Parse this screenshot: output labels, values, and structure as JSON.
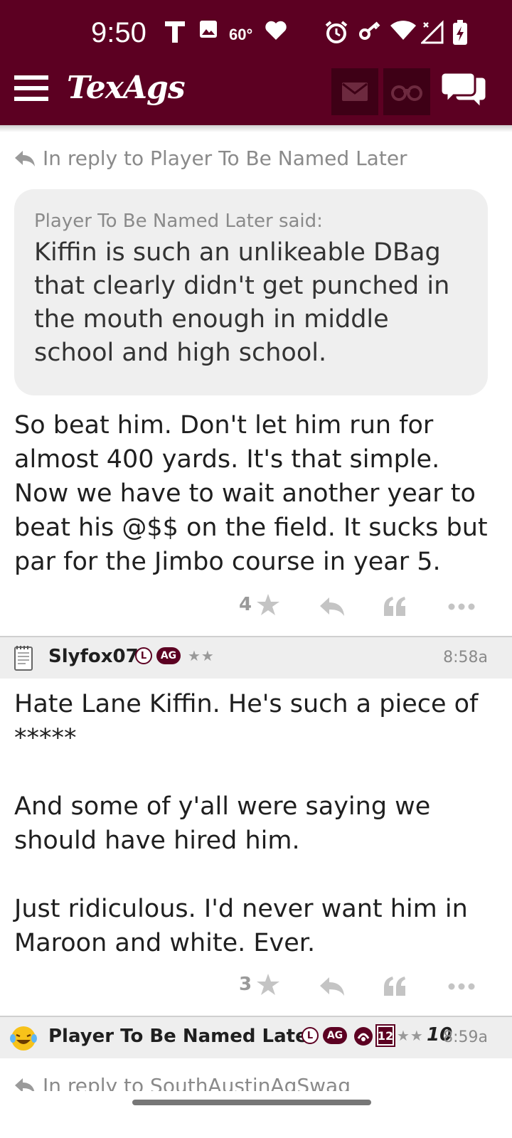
{
  "status_bar": {
    "time": "9:50",
    "temperature": "60°",
    "icons": [
      "t-mobile-icon",
      "image-icon",
      "heart-icon",
      "alarm-icon",
      "key-icon",
      "wifi-icon",
      "signal-icon",
      "battery-charging-icon"
    ]
  },
  "app_bar": {
    "logo": "TexAgs",
    "accent_color": "#5c0022",
    "icons": [
      "menu-icon",
      "mail-icon",
      "binoculars-icon",
      "chat-icon"
    ]
  },
  "posts": [
    {
      "reply_to": "In reply to Player To Be Named Later",
      "quote": {
        "author": "Player To Be Named Later said:",
        "text": "Kiffin is such an unlikeable DBag that clearly didn't get punched in the mouth enough in middle school and high school."
      },
      "body": "So beat him. Don't let him run for almost 400 yards. It's that simple. Now we have to wait another year to beat his @$$ on the field. It sucks but par for the Jimbo course in year 5.",
      "stars": "4"
    },
    {
      "username": "Slyfox07",
      "badge_l": "L",
      "badge_ag": "AG",
      "rank_stars": "★★",
      "time": "8:58a",
      "body": "Hate Lane Kiffin. He's such a piece of *****\n\nAnd some of y'all were saying we should have hired him.\n\nJust ridiculous. I'd never want him in Maroon and white. Ever.",
      "stars": "3"
    },
    {
      "username": "Player To Be Named Later",
      "badge_l": "L",
      "badge_ag": "AG",
      "badge_12": "12",
      "rank_stars": "★★",
      "badge_10": "10",
      "time": "8:59a",
      "reply_to": "In reply to SouthAustinAgSwag"
    }
  ]
}
